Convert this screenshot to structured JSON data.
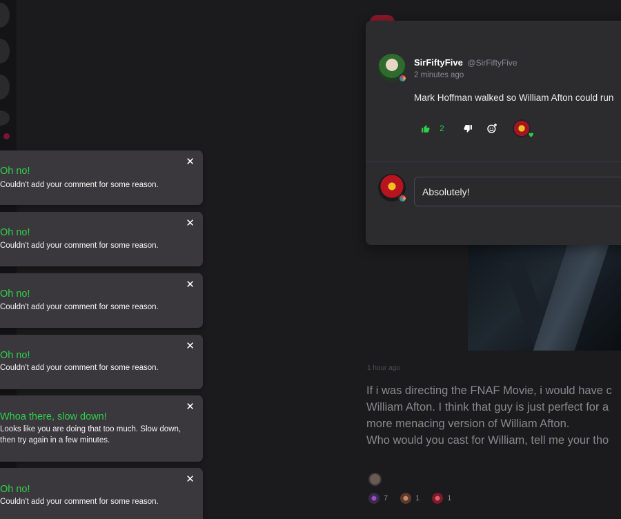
{
  "comment": {
    "author_name": "SirFiftyFive",
    "author_handle": "@SirFiftyFive",
    "time_ago": "2 minutes ago",
    "text": "Mark Hoffman walked so William Afton could run",
    "likes": "2"
  },
  "reply": {
    "value": "Absolutely!"
  },
  "post": {
    "time": "1 hour ago",
    "lines": [
      "If i was directing the FNAF Movie, i would have c",
      "William Afton. I think that guy is just perfect for a",
      "more menacing version of William Afton.",
      "Who would you cast for William, tell me your tho"
    ],
    "reactions": [
      {
        "count": "7"
      },
      {
        "count": "1"
      },
      {
        "count": "1"
      }
    ]
  },
  "toasts": [
    {
      "title": "Oh no!",
      "message": "Couldn't add your comment for some reason.",
      "close": "✕"
    },
    {
      "title": "Oh no!",
      "message": "Couldn't add your comment for some reason.",
      "close": "✕"
    },
    {
      "title": "Oh no!",
      "message": "Couldn't add your comment for some reason.",
      "close": "✕"
    },
    {
      "title": "Oh no!",
      "message": "Couldn't add your comment for some reason.",
      "close": "✕"
    },
    {
      "title": "Whoa there, slow down!",
      "message": "Looks like you are doing that too much. Slow down, then try again in a few minutes.",
      "close": "✕"
    },
    {
      "title": "Oh no!",
      "message": "Couldn't add your comment for some reason.",
      "close": "✕"
    }
  ],
  "colors": {
    "accent_green": "#2fcf4b",
    "background": "#1b1a1c",
    "panel": "#2c2b2e",
    "toast": "#3a383c"
  }
}
